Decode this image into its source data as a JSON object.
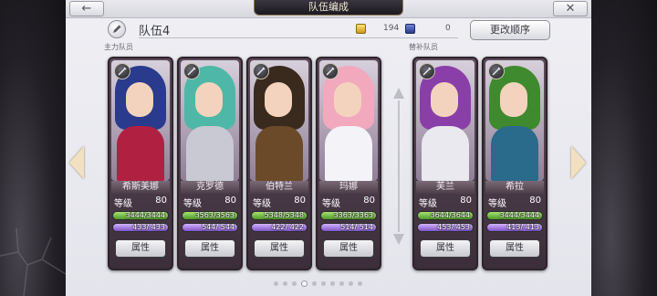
{
  "header": {
    "title": "队伍编成",
    "back_icon": "back-arrow-icon",
    "close_icon": "close-x-icon"
  },
  "team": {
    "name": "队伍4",
    "edit_icon": "pencil-icon"
  },
  "resources": [
    {
      "icon": "gold-crystal-icon",
      "value": "194",
      "color": "#e1b63a"
    },
    {
      "icon": "blue-crystal-icon",
      "value": "0",
      "color": "#3b4ca3"
    }
  ],
  "reorder_label": "更改顺序",
  "sections": {
    "main": "主力队员",
    "reserve": "替补队员"
  },
  "labels": {
    "level": "等级",
    "attribute": "属性"
  },
  "main_team": [
    {
      "name": "希斯美娜",
      "level": "80",
      "hp": "3444/3444",
      "sp": "433/ 433",
      "hair": "#2a3a8c",
      "outfit": "#b02040"
    },
    {
      "name": "克罗德",
      "level": "80",
      "hp": "3563/3563",
      "sp": "544/ 544",
      "hair": "#4fb7a8",
      "outfit": "#c9c9d3"
    },
    {
      "name": "伯特兰",
      "level": "80",
      "hp": "5348/5348",
      "sp": "422/ 422",
      "hair": "#3a2a1e",
      "outfit": "#6b4a2a"
    },
    {
      "name": "玛娜",
      "level": "80",
      "hp": "3363/3363",
      "sp": "514/ 514",
      "hair": "#f2a9bd",
      "outfit": "#f4f4f8"
    }
  ],
  "reserve_team": [
    {
      "name": "芙兰",
      "level": "80",
      "hp": "3644/3644",
      "sp": "453/ 453",
      "hair": "#8a3fa8",
      "outfit": "#e9e9ef"
    },
    {
      "name": "希拉",
      "level": "80",
      "hp": "3444/3444",
      "sp": "413/ 413",
      "hair": "#3f8a2e",
      "outfit": "#2a6a8a"
    }
  ],
  "pagination": {
    "count": 10,
    "active": 3
  }
}
